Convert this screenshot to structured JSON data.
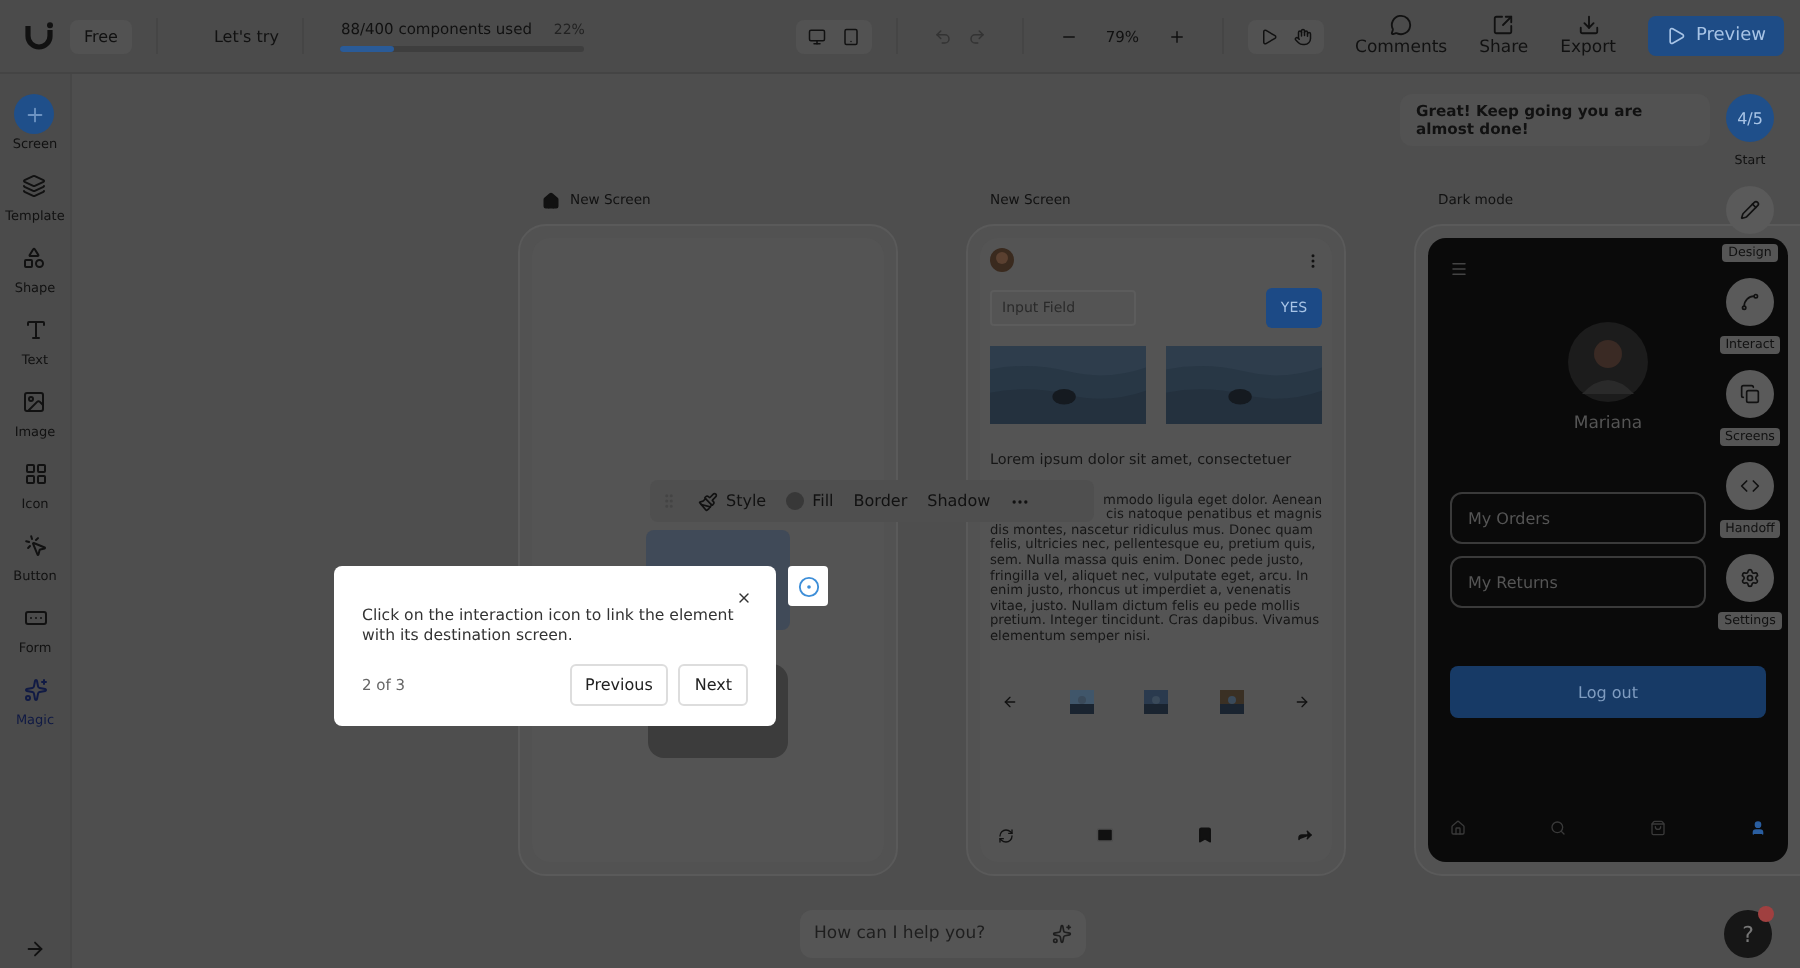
{
  "topbar": {
    "plan": "Free",
    "lets_try": "Let's try",
    "usage": {
      "label": "88/400 components used",
      "percent": "22%",
      "level": 0.22
    },
    "zoom": "79%",
    "actions": [
      "Comments",
      "Share",
      "Export"
    ],
    "preview": "Preview"
  },
  "sidebar": {
    "items": [
      {
        "label": "Screen",
        "kind": "tool",
        "selected": true
      },
      {
        "label": "Template",
        "kind": "tool",
        "selected": false
      },
      {
        "label": "Shape",
        "kind": "tool",
        "selected": false
      },
      {
        "label": "Text",
        "kind": "tool",
        "selected": false
      },
      {
        "label": "Image",
        "kind": "tool",
        "selected": false
      },
      {
        "label": "Icon",
        "kind": "tool",
        "selected": false
      },
      {
        "label": "Button",
        "kind": "tool",
        "selected": false
      },
      {
        "label": "Form",
        "kind": "tool",
        "selected": false
      },
      {
        "label": "Magic",
        "kind": "ai",
        "selected": false
      }
    ]
  },
  "screens": [
    {
      "kind": "blank",
      "title": "New Screen",
      "home": true
    },
    {
      "kind": "content",
      "title": "New Screen",
      "home": false,
      "input_placeholder": "Input Field",
      "button": "YES",
      "heading": "Lorem ipsum dolor sit amet, consectetuer",
      "covered_lines": [
        "mmodo ligula eget dolor. Aenean",
        "cis natoque penatibus et magnis"
      ],
      "paragraph": "dis montes, nascetur ridiculus mus. Donec quam felis, ultricies nec, pellentesque eu, pretium quis, sem. Nulla massa quis enim. Donec pede justo, fringilla vel, aliquet nec, vulputate eget, arcu. In enim justo, rhoncus ut imperdiet a, venenatis vitae, justo. Nullam dictum felis eu pede mollis pretium. Integer tincidunt. Cras dapibus. Vivamus elementum semper nisi."
    },
    {
      "kind": "profile",
      "title": "Dark mode",
      "home": false,
      "name": "Mariana",
      "fields": [
        "My Orders",
        "My Returns"
      ],
      "button": "Log out",
      "nav": [
        {
          "selected": false
        },
        {
          "selected": false
        },
        {
          "selected": false
        },
        {
          "selected": true
        }
      ]
    }
  ],
  "tour": {
    "message": "Great! Keep going you are almost done!",
    "progress": "4/5",
    "start": "Start"
  },
  "rail": [
    "Design",
    "Interact",
    "Screens",
    "Handoff",
    "Settings"
  ],
  "element_toolbar": [
    "Style",
    "Fill",
    "Border",
    "Shadow"
  ],
  "tooltip": {
    "text": "Click on the interaction icon to link the element with its destination screen.",
    "step": "2 of 3",
    "buttons": [
      "Previous",
      "Next"
    ]
  },
  "chat": {
    "placeholder": "How can I help you?"
  },
  "help": "?"
}
